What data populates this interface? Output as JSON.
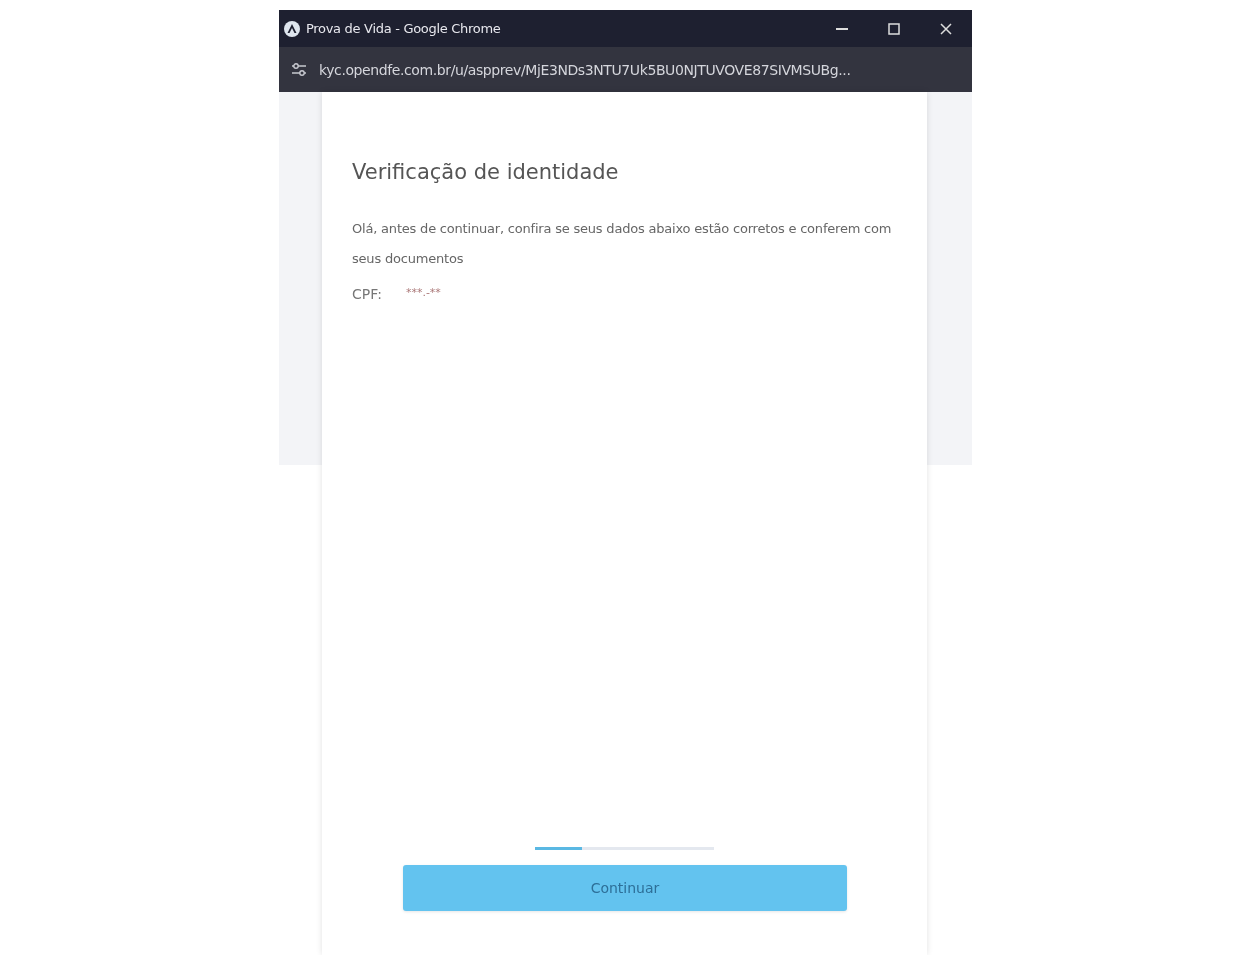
{
  "window": {
    "title": "Prova de Vida - Google Chrome"
  },
  "address_bar": {
    "url": "kyc.opendfe.com.br/u/aspprev/MjE3NDs3NTU7Uk5BU0NJTUVOVE87SIVMSUBg..."
  },
  "page": {
    "title": "Verificação de identidade",
    "intro": "Olá, antes de continuar, confira se seus dados abaixo estão corretos e conferem com seus documentos",
    "fields": [
      {
        "label": "CPF:",
        "value": "***.-**"
      }
    ],
    "progress": {
      "level": 0.26
    },
    "button": {
      "label": "Continuar"
    }
  }
}
